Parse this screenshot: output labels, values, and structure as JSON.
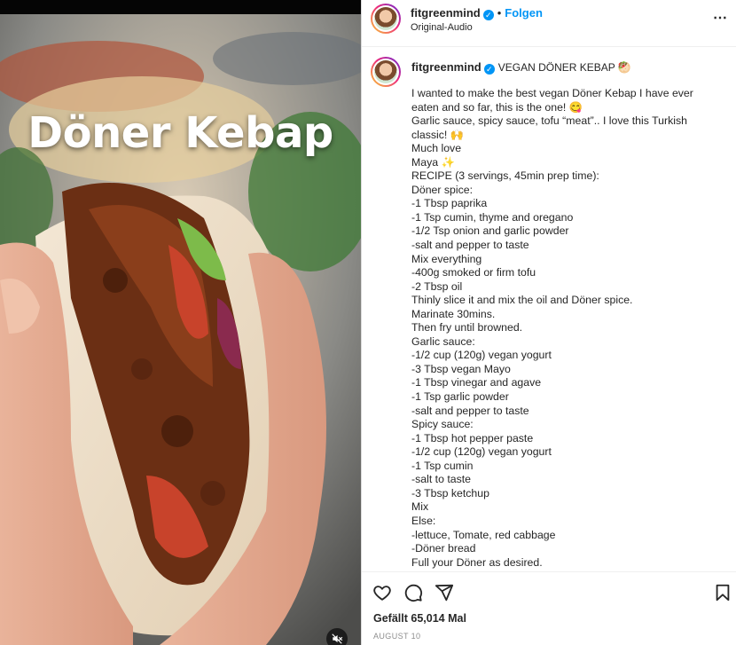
{
  "media": {
    "overlay_title": "Döner Kebap",
    "mute_icon": "speaker-muted-icon"
  },
  "header": {
    "username": "fitgreenmind",
    "separator": "•",
    "follow_label": "Folgen",
    "audio_label": "Original-Audio",
    "more_icon": "more-options-icon"
  },
  "caption": {
    "username": "fitgreenmind",
    "headline": "VEGAN DÖNER KEBAP 🥙",
    "lines": [
      "I wanted to make the best vegan Döner Kebap I have ever",
      "eaten and so far, this is the one! 😋",
      "Garlic sauce, spicy sauce, tofu “meat”.. I love this Turkish",
      "classic! 🙌",
      "Much love",
      "Maya ✨",
      "RECIPE (3 servings, 45min prep time):",
      "Döner spice:",
      "-1 Tbsp paprika",
      "-1 Tsp cumin, thyme and oregano",
      "-1/2 Tsp onion and garlic powder",
      "-salt and pepper to taste",
      "Mix everything",
      "-400g smoked or firm tofu",
      "-2 Tbsp oil",
      "Thinly slice it and mix the oil and Döner spice.",
      "Marinate 30mins.",
      "Then fry until browned.",
      "Garlic sauce:",
      "-1/2 cup (120g) vegan yogurt",
      "-3 Tbsp vegan Mayo",
      "-1 Tbsp vinegar and agave",
      "-1 Tsp garlic powder",
      "-salt and pepper to taste",
      "Spicy sauce:",
      "-1 Tbsp hot pepper paste",
      "-1/2 cup (120g) vegan yogurt",
      "-1 Tsp cumin",
      "-salt to taste",
      "-3 Tbsp ketchup",
      "Mix",
      "Else:",
      "-lettuce, Tomate, red cabbage",
      "-Döner bread",
      "Full your Döner as desired."
    ]
  },
  "actions": {
    "icons": [
      "heart-icon",
      "comment-icon",
      "share-icon",
      "bookmark-icon"
    ]
  },
  "footer": {
    "likes": "Gefällt 65,014 Mal",
    "date": "AUGUST 10"
  },
  "colors": {
    "link_blue": "#0095f6",
    "text": "#262626",
    "muted": "#8e8e8e"
  }
}
